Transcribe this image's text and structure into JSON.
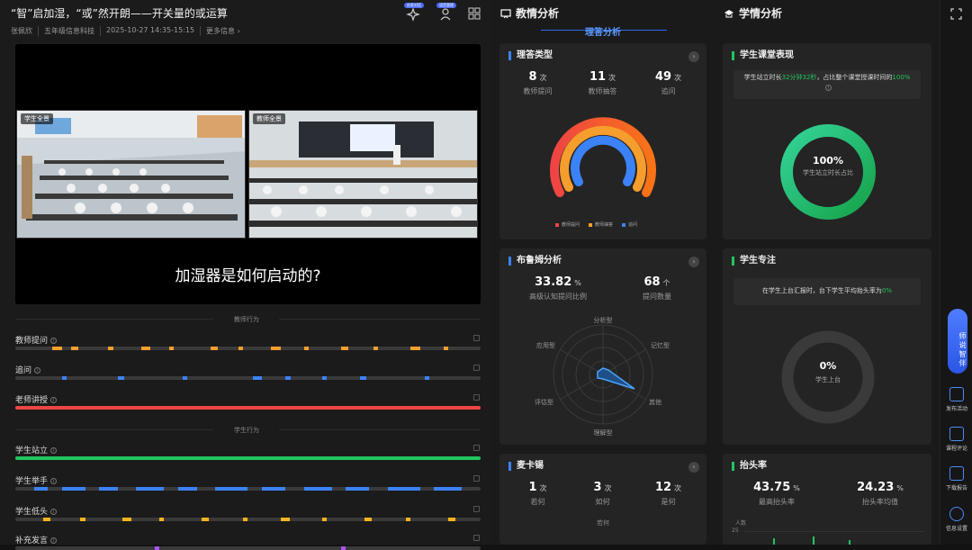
{
  "header": {
    "title": "“智”启加湿，“或”然开朗——开关量的或运算",
    "teacher": "张佩欣",
    "course": "五年级信息科技",
    "time": "2025-10-27 14:35-15:15",
    "more": "更多信息 ›",
    "icon_badges": [
      "启发对话",
      "语音管理"
    ]
  },
  "video": {
    "cam1_label": "学生全景",
    "cam2_label": "教师全景",
    "subtitle": "加湿器是如何启动的?"
  },
  "behavior": {
    "teacher_section": "教师行为",
    "student_section": "学生行为",
    "tracks": [
      {
        "label": "教师提问",
        "color": "#f59e2d",
        "key": "t1"
      },
      {
        "label": "追问",
        "color": "#3b82f6",
        "key": "t2"
      },
      {
        "label": "老师讲授",
        "color": "#ef4444",
        "key": "t3"
      },
      {
        "label": "学生站立",
        "color": "#22c55e",
        "key": "s1"
      },
      {
        "label": "学生举手",
        "color": "#3b82f6",
        "key": "s2"
      },
      {
        "label": "学生低头",
        "color": "#f5b41d",
        "key": "s3"
      },
      {
        "label": "补充发言",
        "color": "#a855f7",
        "key": "s4"
      }
    ]
  },
  "col2": {
    "header": "教情分析",
    "sub": "理答分析",
    "type_card": {
      "title": "理答类型",
      "stats": [
        {
          "num": "8",
          "unit": "次",
          "label": "教师提问"
        },
        {
          "num": "11",
          "unit": "次",
          "label": "教师抽答"
        },
        {
          "num": "49",
          "unit": "次",
          "label": "追问"
        }
      ],
      "legend": [
        {
          "label": "教师提问",
          "color": "#ef4444"
        },
        {
          "label": "教师抽答",
          "color": "#f59e2d"
        },
        {
          "label": "追问",
          "color": "#3b82f6"
        }
      ]
    },
    "bloom_card": {
      "title": "布鲁姆分析",
      "stats": [
        {
          "num": "33.82",
          "unit": "%",
          "label": "高级认知提问比例"
        },
        {
          "num": "68",
          "unit": "个",
          "label": "提问数量"
        }
      ],
      "radar_labels": [
        "分析型",
        "记忆型",
        "其他",
        "理解型",
        "评估型",
        "应用型"
      ]
    },
    "mc_card": {
      "title": "麦卡锡",
      "stats": [
        {
          "num": "1",
          "unit": "次",
          "label": "若何"
        },
        {
          "num": "3",
          "unit": "次",
          "label": "如何"
        },
        {
          "num": "12",
          "unit": "次",
          "label": "是何"
        }
      ],
      "extra": "若何"
    }
  },
  "col3": {
    "header": "学情分析",
    "perf_card": {
      "title": "学生课堂表现",
      "note_a": "学生站立时长",
      "note_hl1": "32分钟32秒",
      "note_b": "，占比整个课堂授课时间的",
      "note_hl2": "100%",
      "pct": "100%",
      "pct_label": "学生站立时长占比"
    },
    "focus_card": {
      "title": "学生专注",
      "note_a": "在学生上台汇报时，台下学生平均抬头率为",
      "note_hl": "0%",
      "pct": "0%",
      "pct_label": "学生上台"
    },
    "head_card": {
      "title": "抬头率",
      "stats": [
        {
          "num": "43.75",
          "unit": "%",
          "label": "最高抬头率"
        },
        {
          "num": "24.23",
          "unit": "%",
          "label": "抬头率均值"
        }
      ],
      "axis_label": "人数",
      "axis_tick": "25"
    }
  },
  "rail": {
    "assistant": "师说智伴",
    "items": [
      "发布活动",
      "课程评论",
      "下载报告",
      "信息设置"
    ]
  },
  "chart_data": [
    {
      "type": "pie",
      "title": "理答类型",
      "categories": [
        "教师提问",
        "教师抽答",
        "追问"
      ],
      "values": [
        8,
        11,
        49
      ]
    },
    {
      "type": "pie",
      "title": "学生课堂表现",
      "categories": [
        "学生站立时长占比"
      ],
      "values": [
        100
      ]
    },
    {
      "type": "pie",
      "title": "学生专注",
      "categories": [
        "学生上台"
      ],
      "values": [
        0
      ]
    }
  ]
}
